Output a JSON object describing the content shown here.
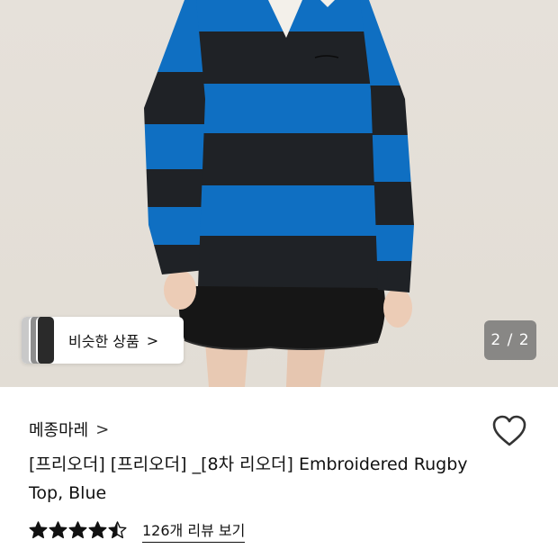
{
  "gallery": {
    "similar_label": "비슷한 상품",
    "page_counter": "2 / 2",
    "current_page": 2,
    "total_pages": 2
  },
  "product": {
    "brand": "메종마레",
    "title": "[프리오더] [프리오더] _[8차 리오더] Embroidered Rugby Top, Blue",
    "rating": 4.5,
    "review_link": "126개 리뷰 보기"
  },
  "icons": {
    "brand_chevron": "chevron-right-icon",
    "wishlist": "heart-outline-icon",
    "chip_chevron": "chevron-right-icon"
  },
  "colors": {
    "stripe_blue": "#0f6fc2",
    "stripe_black": "#1f2226",
    "star": "#111111"
  }
}
